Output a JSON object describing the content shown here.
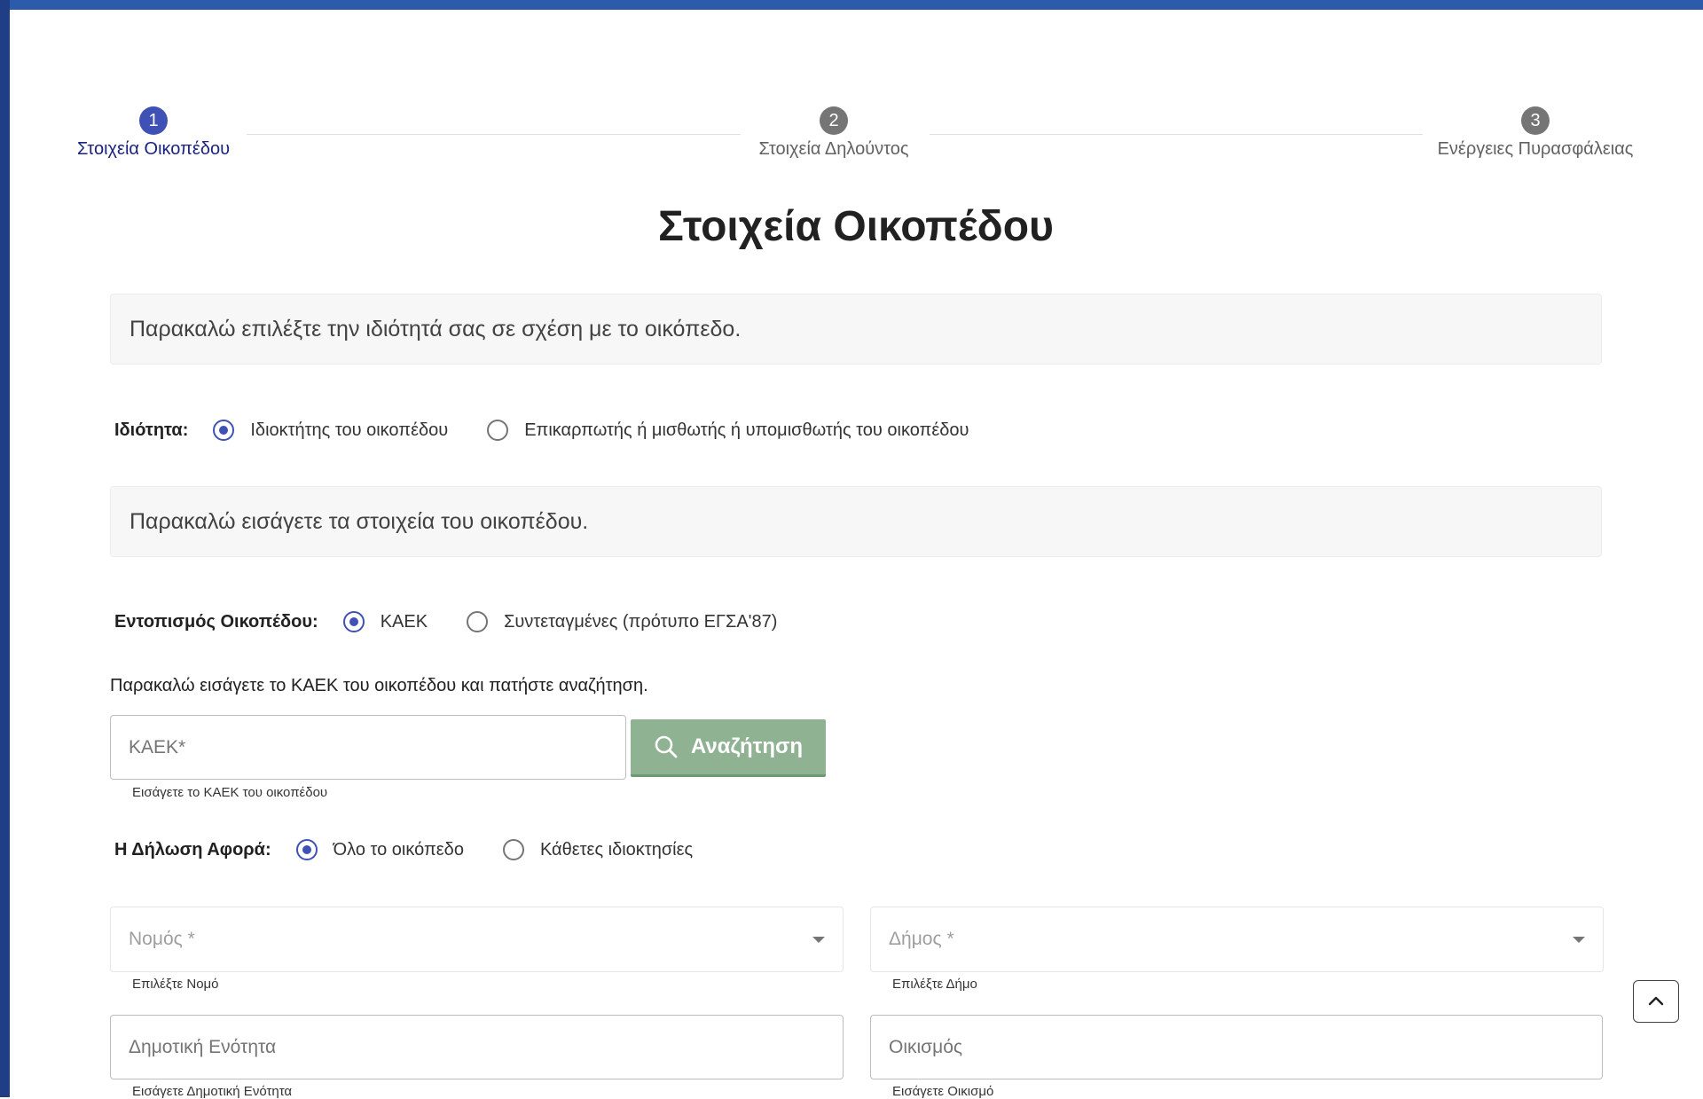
{
  "stepper": {
    "steps": [
      {
        "number": "1",
        "label": "Στοιχεία Οικοπέδου",
        "state": "active"
      },
      {
        "number": "2",
        "label": "Στοιχεία Δηλούντος",
        "state": "inactive"
      },
      {
        "number": "3",
        "label": "Ενέργειες Πυρασφάλειας",
        "state": "inactive"
      }
    ]
  },
  "page": {
    "title": "Στοιχεία Οικοπέδου"
  },
  "property_info": {
    "message": "Παρακαλώ επιλέξτε την ιδιότητά σας σε σχέση με το οικόπεδο.",
    "label": "Ιδιότητα:",
    "options": [
      "Ιδιοκτήτης του οικοπέδου",
      "Επικαρπωτής ή μισθωτής ή υπομισθωτής του οικοπέδου"
    ],
    "selected": "Ιδιοκτήτης του οικοπέδου"
  },
  "plot_info": {
    "message": "Παρακαλώ εισάγετε τα στοιχεία του οικοπέδου."
  },
  "location": {
    "label": "Εντοπισμός Οικοπέδου:",
    "options": [
      "ΚΑΕΚ",
      "Συντεταγμένες (πρότυπο ΕΓΣΑ'87)"
    ],
    "selected": "ΚΑΕΚ"
  },
  "kaek": {
    "instruction": "Παρακαλώ εισάγετε το ΚΑΕΚ του οικοπέδου και πατήστε αναζήτηση.",
    "placeholder": "ΚΑΕΚ*",
    "value": "",
    "helper": "Εισάγετε το ΚΑΕΚ του οικοπέδου",
    "search_label": "Αναζήτηση",
    "search_icon": "search-icon"
  },
  "declaration": {
    "label": "Η Δήλωση Αφορά:",
    "options": [
      "Όλο το οικόπεδο",
      "Κάθετες ιδιοκτησίες"
    ],
    "selected": "Όλο το οικόπεδο"
  },
  "fields": {
    "prefecture": {
      "placeholder": "Νομός *",
      "helper": "Επιλέξτε Νομό"
    },
    "municipality": {
      "placeholder": "Δήμος *",
      "helper": "Επιλέξτε Δήμο"
    },
    "municipal_unit": {
      "placeholder": "Δημοτική Ενότητα",
      "helper": "Εισάγετε Δημοτική Ενότητα"
    },
    "settlement": {
      "placeholder": "Οικισμός",
      "helper": "Εισάγετε Οικισμό"
    }
  },
  "colors": {
    "accent": "#3f51b5",
    "top_bar": "#2a5cab",
    "search_button": "#8fb292"
  },
  "scroll_top": {
    "icon": "chevron-up-icon"
  }
}
